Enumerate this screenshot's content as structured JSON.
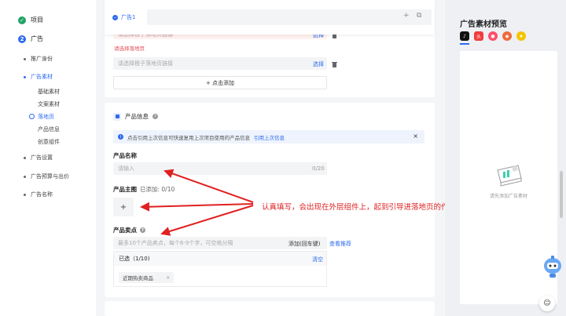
{
  "sidebar": {
    "steps": [
      {
        "num": "✓",
        "label": "项目"
      },
      {
        "num": "2",
        "label": "广告"
      }
    ],
    "nav": {
      "identity": "推广身份",
      "material": "广告素材",
      "material_subs": [
        "基础素材",
        "文案素材",
        "落地页",
        "产品信息",
        "创意组件"
      ],
      "settings": "广告设置",
      "budget": "广告预算与出价",
      "name": "广告名称"
    }
  },
  "tabbar": {
    "tab_label": "广告1",
    "add": "+",
    "copy": "⧉"
  },
  "landing": {
    "err_placeholder": "请选择橙子落地页链接",
    "err_select": "选择",
    "err_text": "请选择落地页",
    "placeholder": "请选择橙子落地页链接",
    "select": "选择",
    "add_btn": "+ 点击添加"
  },
  "product": {
    "section_title": "产品信息",
    "info_text": "点击引用上次信息可快速复用上次项目使用的产品信息",
    "info_link": "引用上次信息",
    "name_label": "产品名称",
    "name_placeholder": "请输入",
    "name_counter": "0/20",
    "main_image_label": "产品主图",
    "main_image_sub": "已添加: 0/10",
    "plus": "+",
    "selling_label": "产品卖点",
    "selling_placeholder": "最多10个产品卖点，每个6-9个字，可空格分隔",
    "selling_add": "添加(回车键)",
    "selling_recommend": "查看推荐",
    "selected_head": "已选（1/10)",
    "selected_clear": "清空",
    "chip": "近期热卖商品",
    "chip_close": "×"
  },
  "annotation": "认真填写，会出现在外层组件上，起到引导进落地页的作用",
  "preview": {
    "title": "广告素材预览",
    "empty": "请先添加广告素材"
  },
  "colors": {
    "accent": "#2e6bf0",
    "success": "#21a366",
    "error": "#e34d59",
    "annotation": "#e02020"
  }
}
